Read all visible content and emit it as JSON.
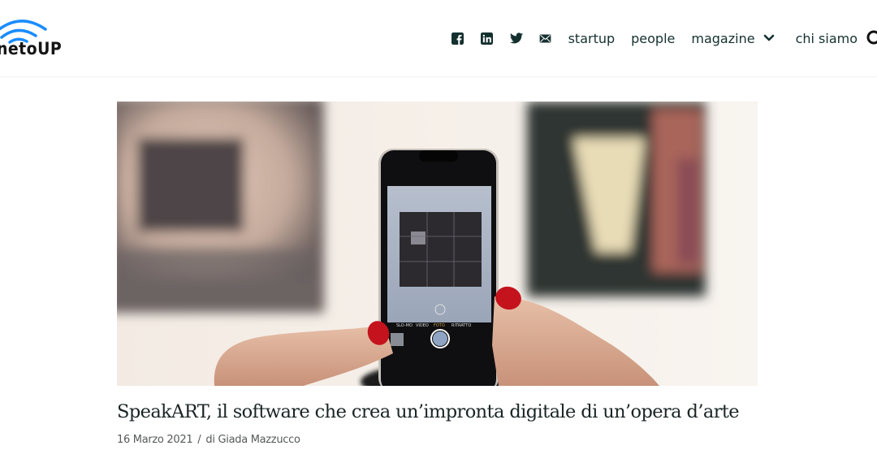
{
  "site": {
    "logo_text": "netoUP",
    "brand_color": "#1a8cff"
  },
  "nav": {
    "social": [
      {
        "name": "facebook-icon",
        "label": "Facebook"
      },
      {
        "name": "linkedin-icon",
        "label": "LinkedIn"
      },
      {
        "name": "twitter-icon",
        "label": "Twitter"
      },
      {
        "name": "email-icon",
        "label": "Email"
      }
    ],
    "links": [
      {
        "label": "startup"
      },
      {
        "label": "people"
      },
      {
        "label": "magazine",
        "has_dropdown": true
      },
      {
        "label": "chi siamo"
      }
    ],
    "search_icon": "search-icon"
  },
  "article": {
    "image_alt": "Hands holding a smartphone photographing a painting in a gallery",
    "phone_modes": [
      "SLO-MO",
      "VIDEO",
      "FOTO",
      "RITRATTO"
    ],
    "title": "SpeakART, il software che crea un’impronta digitale di un’opera d’arte",
    "date": "16 Marzo 2021",
    "separator": "/",
    "author": "di Giada Mazzucco"
  }
}
